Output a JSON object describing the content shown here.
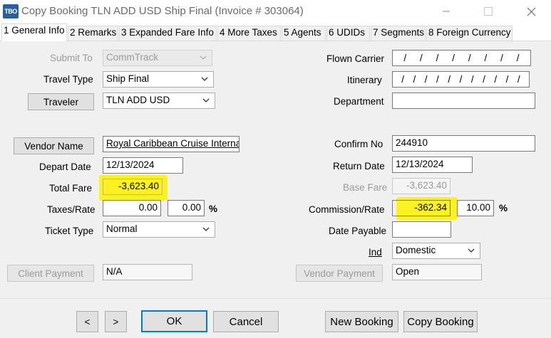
{
  "window": {
    "app_icon_text": "TBO",
    "title": "Copy Booking TLN ADD USD  Ship Final (Invoice # 303064)"
  },
  "tabs": [
    {
      "label": "1 General Info",
      "active": true
    },
    {
      "label": "2 Remarks"
    },
    {
      "label": "3 Expanded Fare Info"
    },
    {
      "label": "4 More Taxes"
    },
    {
      "label": "5 Agents"
    },
    {
      "label": "6 UDIDs"
    },
    {
      "label": "7 Segments"
    },
    {
      "label": "8 Foreign Currency"
    }
  ],
  "left": {
    "submit_to_label": "Submit To",
    "submit_to_value": "CommTrack",
    "travel_type_label": "Travel Type",
    "travel_type_value": "Ship Final",
    "traveler_button": "Traveler",
    "traveler_value": "TLN ADD USD",
    "vendor_name_button": "Vendor Name",
    "vendor_name_value": "Royal Caribbean Cruise Interna",
    "depart_date_label": "Depart Date",
    "depart_date_value": "12/13/2024",
    "total_fare_label": "Total Fare",
    "total_fare_value": "-3,623.40",
    "taxes_rate_label": "Taxes/Rate",
    "taxes_value": "0.00",
    "rate_value": "0.00",
    "percent_sign": "%",
    "ticket_type_label": "Ticket Type",
    "ticket_type_value": "Normal",
    "client_payment_button": "Client Payment",
    "client_payment_value": "N/A"
  },
  "right": {
    "flown_carrier_label": "Flown Carrier",
    "itinerary_label": "Itinerary",
    "department_label": "Department",
    "department_value": "",
    "confirm_no_label": "Confirm No",
    "confirm_no_value": "244910",
    "return_date_label": "Return Date",
    "return_date_value": "12/13/2024",
    "base_fare_label": "Base Fare",
    "base_fare_value": "-3,623.40",
    "commission_rate_label": "Commission/Rate",
    "commission_value": "-362.34",
    "commission_rate_value": "10.00",
    "percent_sign": "%",
    "date_payable_label": "Date Payable",
    "date_payable_value": "",
    "ind_label": "Ind",
    "ind_value": "Domestic",
    "vendor_payment_button": "Vendor Payment",
    "vendor_payment_value": "Open",
    "slash": "/"
  },
  "buttons": {
    "prev": "<",
    "next": ">",
    "ok": "OK",
    "cancel": "Cancel",
    "new_booking": "New Booking",
    "copy_booking": "Copy Booking"
  },
  "colors": {
    "highlight": "#fff100",
    "default_button_border": "#0078d7",
    "app_icon_bg": "#2b5e9e"
  }
}
